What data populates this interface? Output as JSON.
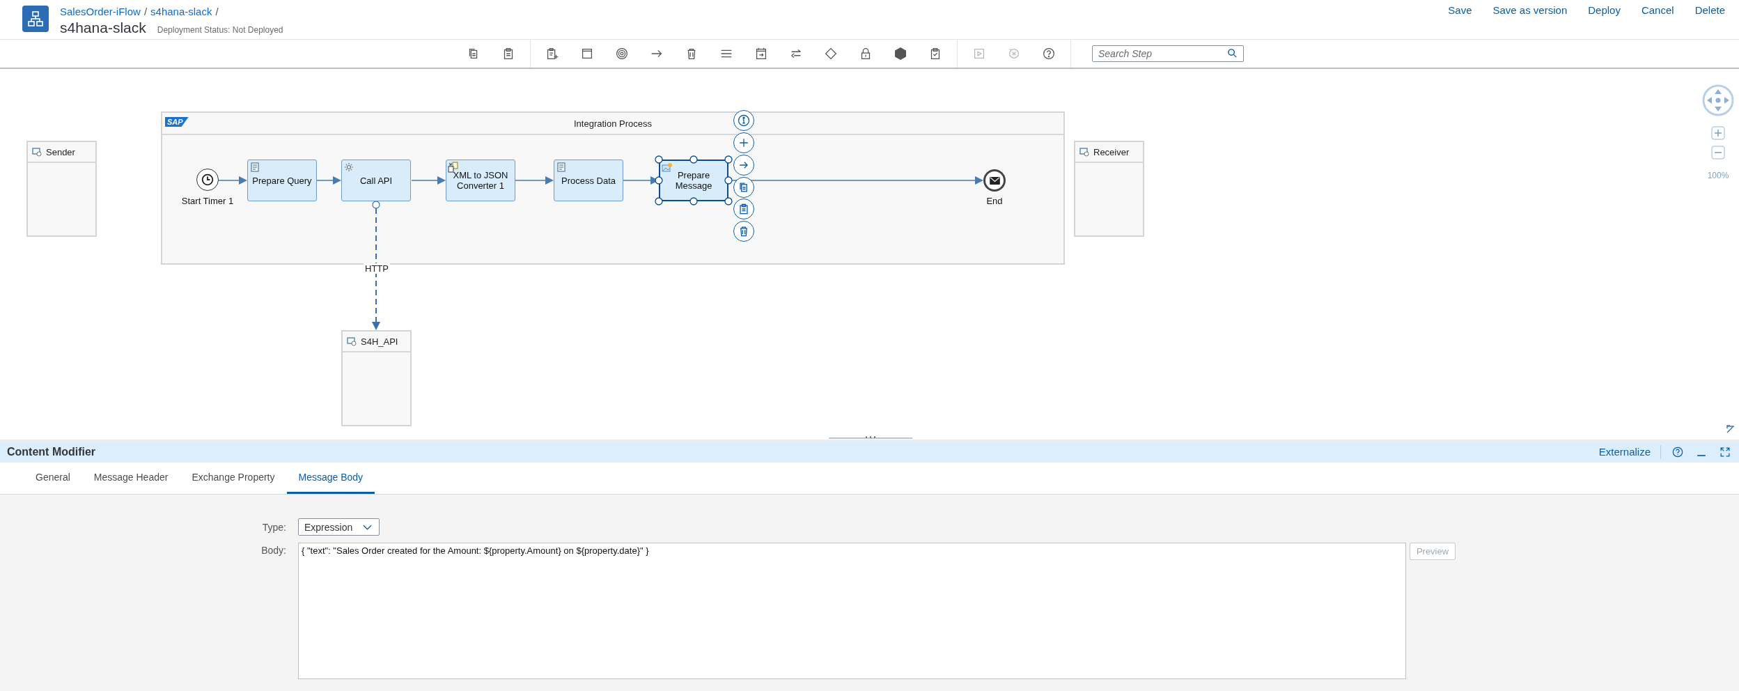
{
  "header": {
    "breadcrumb": [
      {
        "label": "SalesOrder-iFlow"
      },
      {
        "label": "s4hana-slack"
      }
    ],
    "breadcrumb_separator": "/",
    "title": "s4hana-slack",
    "status": "Deployment Status: Not Deployed",
    "actions": [
      "Save",
      "Save as version",
      "Deploy",
      "Cancel",
      "Delete"
    ]
  },
  "toolbar": {
    "groups": [
      [
        {
          "kind": "copy",
          "disabled": false
        },
        {
          "kind": "paste",
          "disabled": false
        }
      ],
      [
        {
          "kind": "add",
          "disabled": false
        },
        {
          "kind": "window",
          "disabled": false
        },
        {
          "kind": "target",
          "disabled": false
        },
        {
          "kind": "arrow",
          "disabled": false
        },
        {
          "kind": "trash",
          "disabled": false
        },
        {
          "kind": "lines",
          "disabled": false
        },
        {
          "kind": "call",
          "disabled": false
        },
        {
          "kind": "swap",
          "disabled": false
        },
        {
          "kind": "diamond",
          "disabled": false
        },
        {
          "kind": "lock",
          "disabled": false
        },
        {
          "kind": "hexagon",
          "disabled": false
        },
        {
          "kind": "check",
          "disabled": false
        }
      ],
      [
        {
          "kind": "play",
          "disabled": true
        },
        {
          "kind": "cancel",
          "disabled": true
        },
        {
          "kind": "help",
          "disabled": false
        }
      ]
    ],
    "search": {
      "placeholder": "Search Step"
    }
  },
  "diagram": {
    "pool": {
      "logo": "SAP",
      "title": "Integration Process"
    },
    "participants": [
      {
        "label": "Sender"
      },
      {
        "label": "Receiver"
      },
      {
        "label": "S4H_API"
      }
    ],
    "start_event": {
      "label": "Start Timer 1"
    },
    "steps": [
      {
        "label": "Prepare Query",
        "kind": "script",
        "selected": false
      },
      {
        "label": "Call API",
        "kind": "request",
        "selected": false
      },
      {
        "label": "XML to JSON Converter 1",
        "kind": "converter",
        "selected": false
      },
      {
        "label": "Process Data",
        "kind": "script",
        "selected": false
      },
      {
        "label": "Prepare Message",
        "kind": "modifier",
        "selected": true
      }
    ],
    "end_event": {
      "label": "End"
    },
    "connection_label": "HTTP",
    "zoom": "100%"
  },
  "panel": {
    "title": "Content Modifier",
    "externalize": "Externalize",
    "tabs": [
      {
        "label": "General",
        "selected": false
      },
      {
        "label": "Message Header",
        "selected": false
      },
      {
        "label": "Exchange Property",
        "selected": false
      },
      {
        "label": "Message Body",
        "selected": true
      }
    ],
    "type_label": "Type:",
    "type_value": "Expression",
    "body_label": "Body:",
    "body_value": "{ \"text\": \"Sales Order created for the Amount: ${property.Amount} on ${property.date}\" }",
    "preview": {
      "label": "Preview",
      "disabled": true
    }
  }
}
